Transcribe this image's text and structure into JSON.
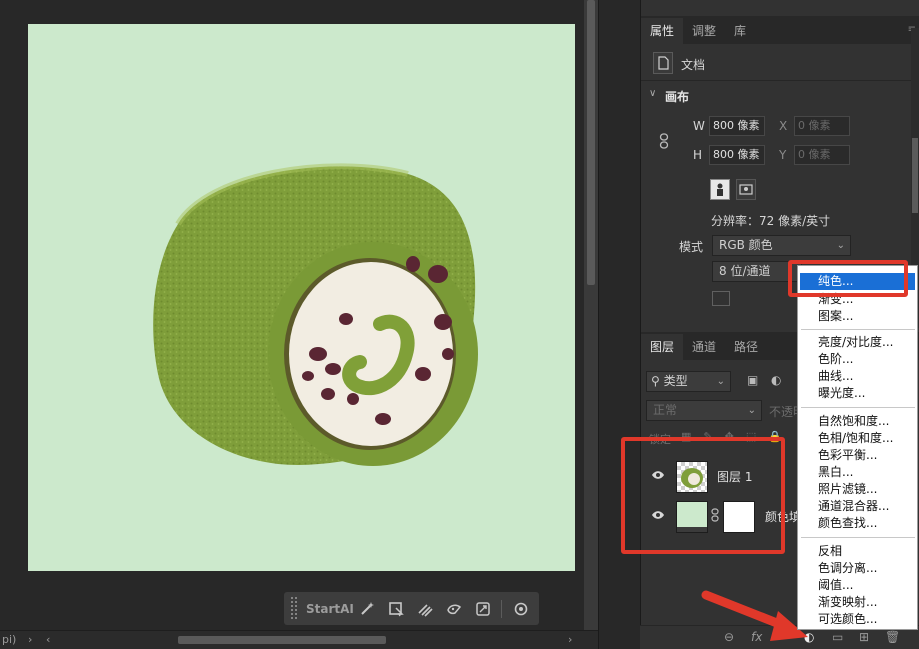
{
  "startai": {
    "label": "StartAI"
  },
  "status": {
    "left_text": "pi)"
  },
  "properties_tabs": [
    "属性",
    "调整",
    "库"
  ],
  "document": {
    "label": "文档"
  },
  "canvas_section": {
    "title": "画布",
    "w_label": "W",
    "w_value": "800 像素",
    "h_label": "H",
    "h_value": "800 像素",
    "x_label": "X",
    "x_value": "0 像素",
    "y_label": "Y",
    "y_value": "0 像素",
    "resolution": "分辨率：72 像素/英寸",
    "mode_label": "模式",
    "mode_value": "RGB 颜色",
    "depth_value": "8 位/通道"
  },
  "layers_tabs": [
    "图层",
    "通道",
    "路径"
  ],
  "layers": {
    "filter_value": "类型",
    "blend_mode": "正常",
    "opacity_label": "不透明",
    "lock_label": "锁定",
    "items": [
      {
        "name": "图层 1"
      },
      {
        "name": "颜色填"
      }
    ]
  },
  "adjust_menu": {
    "groups": [
      [
        "纯色...",
        "渐变...",
        "图案..."
      ],
      [
        "亮度/对比度...",
        "色阶...",
        "曲线...",
        "曝光度..."
      ],
      [
        "自然饱和度...",
        "色相/饱和度...",
        "色彩平衡...",
        "黑白...",
        "照片滤镜...",
        "通道混合器...",
        "颜色查找..."
      ],
      [
        "反相",
        "色调分离...",
        "阈值...",
        "渐变映射...",
        "可选颜色..."
      ]
    ]
  },
  "colors": {
    "canvas_bg": "#cce9cc",
    "highlight": "#1a6fd6",
    "annotation": "#e0382a"
  }
}
